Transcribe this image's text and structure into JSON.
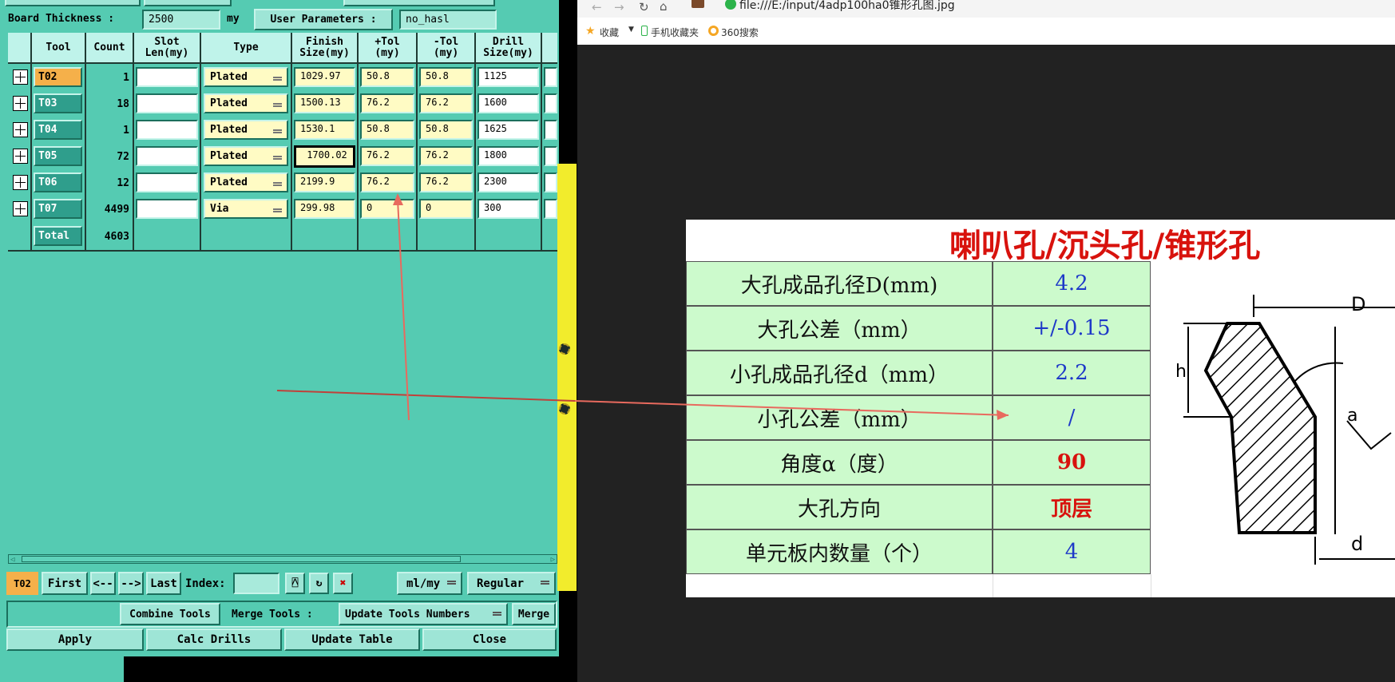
{
  "tool_window": {
    "board_thickness_label": "Board Thickness :",
    "board_thickness_value": "2500",
    "board_thickness_unit": "my",
    "user_params_label": "User Parameters :",
    "user_params_value": "no_hasl",
    "columns": [
      "Tool",
      "Count",
      "Slot Len(my)",
      "Type",
      "Finish Size(my)",
      "+Tol (my)",
      "-Tol (my)",
      "Drill Size(my)"
    ],
    "rows": [
      {
        "tool": "T02",
        "count": "1",
        "slot": "",
        "type": "Plated",
        "finish": "1029.97",
        "ptol": "50.8",
        "mtol": "50.8",
        "drill": "1125"
      },
      {
        "tool": "T03",
        "count": "18",
        "slot": "",
        "type": "Plated",
        "finish": "1500.13",
        "ptol": "76.2",
        "mtol": "76.2",
        "drill": "1600"
      },
      {
        "tool": "T04",
        "count": "1",
        "slot": "",
        "type": "Plated",
        "finish": "1530.1",
        "ptol": "50.8",
        "mtol": "50.8",
        "drill": "1625"
      },
      {
        "tool": "T05",
        "count": "72",
        "slot": "",
        "type": "Plated",
        "finish": "1700.02",
        "ptol": "76.2",
        "mtol": "76.2",
        "drill": "1800"
      },
      {
        "tool": "T06",
        "count": "12",
        "slot": "",
        "type": "Plated",
        "finish": "2199.9",
        "ptol": "76.2",
        "mtol": "76.2",
        "drill": "2300"
      },
      {
        "tool": "T07",
        "count": "4499",
        "slot": "",
        "type": "Via",
        "finish": "299.98",
        "ptol": "0",
        "mtol": "0",
        "drill": "300"
      }
    ],
    "total_label": "Total",
    "total_count": "4603",
    "nav": {
      "current": "T02",
      "first": "First",
      "prev": "<--",
      "next": "-->",
      "last": "Last",
      "index_label": "Index:",
      "units": "ml/my",
      "mode": "Regular"
    },
    "actions": {
      "combine": "Combine Tools",
      "merge_label": "Merge Tools :",
      "update_numbers": "Update Tools Numbers",
      "merge": "Merge"
    },
    "bottom": {
      "apply": "Apply",
      "calc": "Calc Drills",
      "update": "Update Table",
      "close": "Close"
    }
  },
  "browser": {
    "url": "file:///E:/input/4adp100ha0锥形孔图.jpg",
    "bookmarks": [
      "收藏",
      "手机收藏夹",
      "360搜索"
    ]
  },
  "sheet": {
    "title": "喇叭孔/沉头孔/锥形孔",
    "rows": [
      {
        "label": "大孔成品孔径D(mm)",
        "value": "4.2",
        "style": "blue"
      },
      {
        "label": "大孔公差（mm）",
        "value": "+/-0.15",
        "style": "blue"
      },
      {
        "label": "小孔成品孔径d（mm）",
        "value": "2.2",
        "style": "blue"
      },
      {
        "label": "小孔公差（mm）",
        "value": "/",
        "style": "blue"
      },
      {
        "label": "角度α（度）",
        "value": "90",
        "style": "red"
      },
      {
        "label": "大孔方向",
        "value": "顶层",
        "style": "red"
      },
      {
        "label": "单元板内数量（个）",
        "value": "4",
        "style": "blue"
      }
    ],
    "diagram_labels": {
      "D": "D",
      "h": "h",
      "a": "a",
      "d": "d"
    }
  },
  "colors": {
    "panel": "#55cbb2",
    "header": "#bff3ea",
    "tool_cell": "#2f9e8c",
    "selected_tool": "#f5b04a",
    "sheet_green": "#ccfacc",
    "title_red": "#d8120d"
  }
}
